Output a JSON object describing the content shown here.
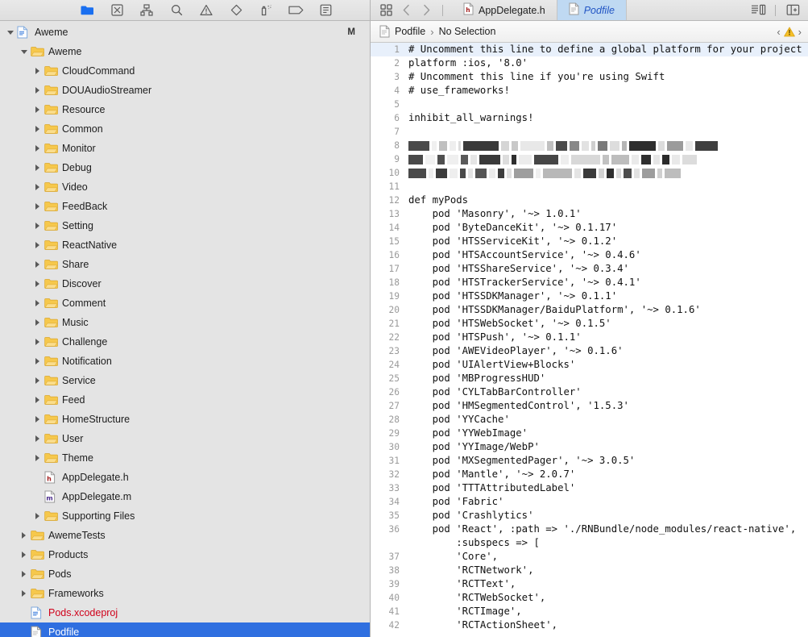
{
  "navigator": {
    "tabs": [
      {
        "name": "project-navigator",
        "icon": "folder-icon",
        "active": true
      },
      {
        "name": "source-control-navigator",
        "icon": "source-control-icon",
        "active": false
      },
      {
        "name": "symbol-navigator",
        "icon": "hierarchy-icon",
        "active": false
      },
      {
        "name": "find-navigator",
        "icon": "search-icon",
        "active": false
      },
      {
        "name": "issue-navigator",
        "icon": "warning-triangle-icon",
        "active": false
      },
      {
        "name": "test-navigator",
        "icon": "diamond-icon",
        "active": false
      },
      {
        "name": "debug-navigator",
        "icon": "spray-can-icon",
        "active": false
      },
      {
        "name": "breakpoint-navigator",
        "icon": "tag-icon",
        "active": false
      },
      {
        "name": "report-navigator",
        "icon": "list-icon",
        "active": false
      }
    ],
    "status_badge": "M",
    "tree": [
      {
        "label": "Aweme",
        "icon": "xcodeproj-icon",
        "depth": 0,
        "state": "open",
        "selected": false,
        "color": "default"
      },
      {
        "label": "Aweme",
        "icon": "folder-icon",
        "depth": 1,
        "state": "open",
        "selected": false,
        "color": "default"
      },
      {
        "label": "CloudCommand",
        "icon": "folder-icon",
        "depth": 2,
        "state": "closed",
        "selected": false,
        "color": "default"
      },
      {
        "label": "DOUAudioStreamer",
        "icon": "folder-icon",
        "depth": 2,
        "state": "closed",
        "selected": false,
        "color": "default"
      },
      {
        "label": "Resource",
        "icon": "folder-icon",
        "depth": 2,
        "state": "closed",
        "selected": false,
        "color": "default"
      },
      {
        "label": "Common",
        "icon": "folder-icon",
        "depth": 2,
        "state": "closed",
        "selected": false,
        "color": "default"
      },
      {
        "label": "Monitor",
        "icon": "folder-icon",
        "depth": 2,
        "state": "closed",
        "selected": false,
        "color": "default"
      },
      {
        "label": "Debug",
        "icon": "folder-icon",
        "depth": 2,
        "state": "closed",
        "selected": false,
        "color": "default"
      },
      {
        "label": "Video",
        "icon": "folder-icon",
        "depth": 2,
        "state": "closed",
        "selected": false,
        "color": "default"
      },
      {
        "label": "FeedBack",
        "icon": "folder-icon",
        "depth": 2,
        "state": "closed",
        "selected": false,
        "color": "default"
      },
      {
        "label": "Setting",
        "icon": "folder-icon",
        "depth": 2,
        "state": "closed",
        "selected": false,
        "color": "default"
      },
      {
        "label": "ReactNative",
        "icon": "folder-icon",
        "depth": 2,
        "state": "closed",
        "selected": false,
        "color": "default"
      },
      {
        "label": "Share",
        "icon": "folder-icon",
        "depth": 2,
        "state": "closed",
        "selected": false,
        "color": "default"
      },
      {
        "label": "Discover",
        "icon": "folder-icon",
        "depth": 2,
        "state": "closed",
        "selected": false,
        "color": "default"
      },
      {
        "label": "Comment",
        "icon": "folder-icon",
        "depth": 2,
        "state": "closed",
        "selected": false,
        "color": "default"
      },
      {
        "label": "Music",
        "icon": "folder-icon",
        "depth": 2,
        "state": "closed",
        "selected": false,
        "color": "default"
      },
      {
        "label": "Challenge",
        "icon": "folder-icon",
        "depth": 2,
        "state": "closed",
        "selected": false,
        "color": "default"
      },
      {
        "label": "Notification",
        "icon": "folder-icon",
        "depth": 2,
        "state": "closed",
        "selected": false,
        "color": "default"
      },
      {
        "label": "Service",
        "icon": "folder-icon",
        "depth": 2,
        "state": "closed",
        "selected": false,
        "color": "default"
      },
      {
        "label": "Feed",
        "icon": "folder-icon",
        "depth": 2,
        "state": "closed",
        "selected": false,
        "color": "default"
      },
      {
        "label": "HomeStructure",
        "icon": "folder-icon",
        "depth": 2,
        "state": "closed",
        "selected": false,
        "color": "default"
      },
      {
        "label": "User",
        "icon": "folder-icon",
        "depth": 2,
        "state": "closed",
        "selected": false,
        "color": "default"
      },
      {
        "label": "Theme",
        "icon": "folder-icon",
        "depth": 2,
        "state": "closed",
        "selected": false,
        "color": "default"
      },
      {
        "label": "AppDelegate.h",
        "icon": "header-file-icon",
        "depth": 2,
        "state": "none",
        "selected": false,
        "color": "default"
      },
      {
        "label": "AppDelegate.m",
        "icon": "implementation-file-icon",
        "depth": 2,
        "state": "none",
        "selected": false,
        "color": "default"
      },
      {
        "label": "Supporting Files",
        "icon": "folder-icon",
        "depth": 2,
        "state": "closed",
        "selected": false,
        "color": "default"
      },
      {
        "label": "AwemeTests",
        "icon": "folder-icon",
        "depth": 1,
        "state": "closed",
        "selected": false,
        "color": "default"
      },
      {
        "label": "Products",
        "icon": "folder-icon",
        "depth": 1,
        "state": "closed",
        "selected": false,
        "color": "default"
      },
      {
        "label": "Pods",
        "icon": "folder-icon",
        "depth": 1,
        "state": "closed",
        "selected": false,
        "color": "default"
      },
      {
        "label": "Frameworks",
        "icon": "folder-icon",
        "depth": 1,
        "state": "closed",
        "selected": false,
        "color": "default"
      },
      {
        "label": "Pods.xcodeproj",
        "icon": "xcodeproj-icon",
        "depth": 1,
        "state": "none",
        "selected": false,
        "color": "red"
      },
      {
        "label": "Podfile",
        "icon": "plain-file-icon",
        "depth": 1,
        "state": "none",
        "selected": true,
        "color": "default"
      }
    ]
  },
  "editor": {
    "toolbar_left_icons": [
      "related-items-icon",
      "back-arrow-icon",
      "forward-arrow-icon"
    ],
    "toolbar_right_icons": [
      "standard-editor-icon",
      "assistant-editor-icon"
    ],
    "tabs": [
      {
        "label": "AppDelegate.h",
        "icon": "header-file-icon",
        "active": false
      },
      {
        "label": "Podfile",
        "icon": "plain-file-icon",
        "active": true
      }
    ],
    "jumpbar": {
      "file_icon": "plain-file-icon",
      "file": "Podfile",
      "separator": "›",
      "selection": "No Selection",
      "prev_issue_icon": "chevron-left-icon",
      "issue_icon": "warning-triangle-icon",
      "next_issue_icon": "chevron-right-icon"
    },
    "current_line": 1,
    "lines": [
      {
        "n": "1",
        "text": "# Uncomment this line to define a global platform for your project",
        "redacted": false
      },
      {
        "n": "2",
        "text": "platform :ios, '8.0'",
        "redacted": false
      },
      {
        "n": "3",
        "text": "# Uncomment this line if you're using Swift",
        "redacted": false
      },
      {
        "n": "4",
        "text": "# use_frameworks!",
        "redacted": false
      },
      {
        "n": "5",
        "text": "",
        "redacted": false
      },
      {
        "n": "6",
        "text": "inhibit_all_warnings!",
        "redacted": false
      },
      {
        "n": "7",
        "text": "",
        "redacted": false
      },
      {
        "n": "8",
        "text": "source",
        "redacted": true
      },
      {
        "n": "9",
        "text": "source",
        "redacted": true
      },
      {
        "n": "10",
        "text": "source",
        "redacted": true
      },
      {
        "n": "11",
        "text": "",
        "redacted": false
      },
      {
        "n": "12",
        "text": "def myPods",
        "redacted": false
      },
      {
        "n": "13",
        "text": "    pod 'Masonry', '~> 1.0.1'",
        "redacted": false
      },
      {
        "n": "14",
        "text": "    pod 'ByteDanceKit', '~> 0.1.17'",
        "redacted": false
      },
      {
        "n": "15",
        "text": "    pod 'HTSServiceKit', '~> 0.1.2'",
        "redacted": false
      },
      {
        "n": "16",
        "text": "    pod 'HTSAccountService', '~> 0.4.6'",
        "redacted": false
      },
      {
        "n": "17",
        "text": "    pod 'HTSShareService', '~> 0.3.4'",
        "redacted": false
      },
      {
        "n": "18",
        "text": "    pod 'HTSTrackerService', '~> 0.4.1'",
        "redacted": false
      },
      {
        "n": "19",
        "text": "    pod 'HTSSDKManager', '~> 0.1.1'",
        "redacted": false
      },
      {
        "n": "20",
        "text": "    pod 'HTSSDKManager/BaiduPlatform', '~> 0.1.6'",
        "redacted": false
      },
      {
        "n": "21",
        "text": "    pod 'HTSWebSocket', '~> 0.1.5'",
        "redacted": false
      },
      {
        "n": "22",
        "text": "    pod 'HTSPush', '~> 0.1.1'",
        "redacted": false
      },
      {
        "n": "23",
        "text": "    pod 'AWEVideoPlayer', '~> 0.1.6'",
        "redacted": false
      },
      {
        "n": "24",
        "text": "    pod 'UIAlertView+Blocks'",
        "redacted": false
      },
      {
        "n": "25",
        "text": "    pod 'MBProgressHUD'",
        "redacted": false
      },
      {
        "n": "26",
        "text": "    pod 'CYLTabBarController'",
        "redacted": false
      },
      {
        "n": "27",
        "text": "    pod 'HMSegmentedControl', '1.5.3'",
        "redacted": false
      },
      {
        "n": "28",
        "text": "    pod 'YYCache'",
        "redacted": false
      },
      {
        "n": "29",
        "text": "    pod 'YYWebImage'",
        "redacted": false
      },
      {
        "n": "30",
        "text": "    pod 'YYImage/WebP'",
        "redacted": false
      },
      {
        "n": "31",
        "text": "    pod 'MXSegmentedPager', '~> 3.0.5'",
        "redacted": false
      },
      {
        "n": "32",
        "text": "    pod 'Mantle', '~> 2.0.7'",
        "redacted": false
      },
      {
        "n": "33",
        "text": "    pod 'TTTAttributedLabel'",
        "redacted": false
      },
      {
        "n": "34",
        "text": "    pod 'Fabric'",
        "redacted": false
      },
      {
        "n": "35",
        "text": "    pod 'Crashlytics'",
        "redacted": false
      },
      {
        "n": "36",
        "text": "    pod 'React', :path => './RNBundle/node_modules/react-native',",
        "redacted": false
      },
      {
        "n": "",
        "text": "        :subspecs => [",
        "redacted": false
      },
      {
        "n": "37",
        "text": "        'Core',",
        "redacted": false
      },
      {
        "n": "38",
        "text": "        'RCTNetwork',",
        "redacted": false
      },
      {
        "n": "39",
        "text": "        'RCTText',",
        "redacted": false
      },
      {
        "n": "40",
        "text": "        'RCTWebSocket',",
        "redacted": false
      },
      {
        "n": "41",
        "text": "        'RCTImage',",
        "redacted": false
      },
      {
        "n": "42",
        "text": "        'RCTActionSheet',",
        "redacted": false
      }
    ]
  },
  "colors": {
    "selection_blue": "#2f6fe0",
    "active_tab_blue": "#bfd9f2",
    "active_tab_text": "#2255c4",
    "missing_file_red": "#d0021b",
    "navigator_bg": "#e4e4e4",
    "folder_yellow": "#f5c84c",
    "current_line_highlight": "#e8f0fb"
  }
}
